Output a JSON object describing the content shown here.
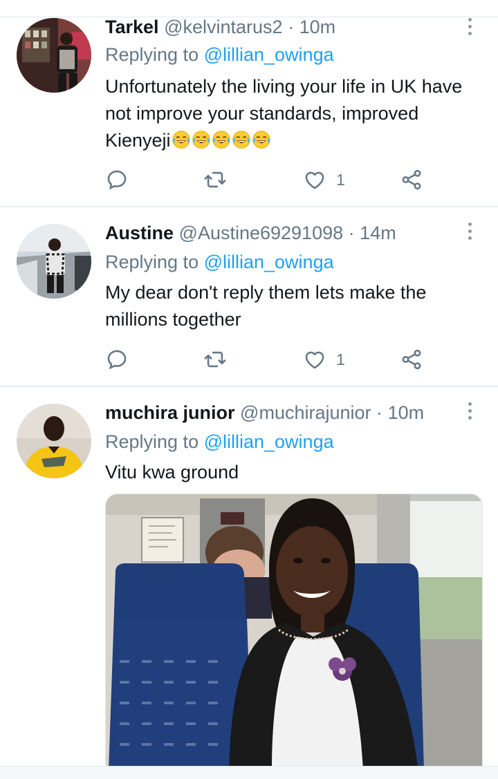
{
  "colors": {
    "accent": "#1da1f2",
    "muted": "#657786",
    "text": "#14171a",
    "divider": "#e6ecf0"
  },
  "tweets": [
    {
      "name": "Tarkel",
      "handle": "@kelvintarus2",
      "sep": "·",
      "time": "10m",
      "replying_prefix": "Replying to ",
      "replying_handle": "@lillian_owinga",
      "text": "Unfortunately the living your life in UK have not improve your standards, improved Kienyeji",
      "emoji_count": 5,
      "emoji_name": "tears-of-joy-emoji",
      "likes": "1"
    },
    {
      "name": "Austine",
      "handle": "@Austine69291098",
      "sep": "·",
      "time": "14m",
      "replying_prefix": "Replying to ",
      "replying_handle": "@lillian_owinga",
      "text": "My dear don't reply them lets make the millions together",
      "likes": "1"
    },
    {
      "name": "muchira junior",
      "handle": "@muchirajunior",
      "sep": "·",
      "time": "10m",
      "replying_prefix": "Replying to ",
      "replying_handle": "@lillian_owinga",
      "text": "Vitu kwa ground",
      "has_media": true
    }
  ],
  "icons": {
    "reply": "reply-icon",
    "retweet": "retweet-icon",
    "like": "heart-icon",
    "share": "share-icon",
    "more": "more-vertical-icon"
  }
}
